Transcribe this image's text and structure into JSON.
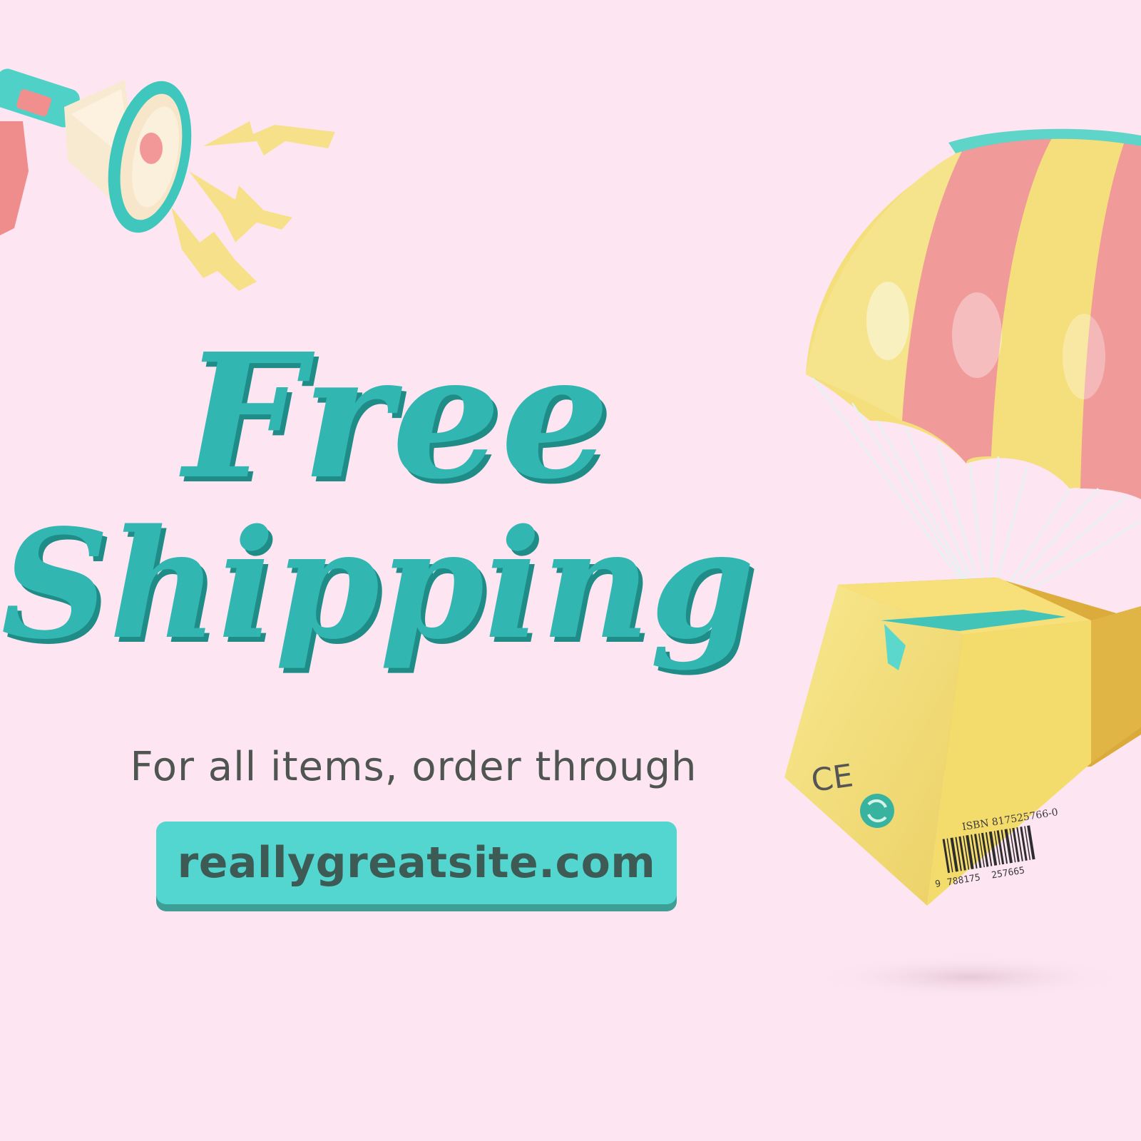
{
  "headline": {
    "line1": "Free",
    "line2": "Shipping"
  },
  "subtitle": "For all items, order through",
  "cta": {
    "url": "reallygreatsite.com"
  },
  "box": {
    "mark": "CE",
    "isbn": "ISBN 817525766-0",
    "barcode_left": "9",
    "barcode_mid": "788175",
    "barcode_right": "257665"
  },
  "colors": {
    "background": "#fde6f2",
    "teal": "#32b6b1",
    "teal_dark": "#1f8c87",
    "button": "#53d6cf",
    "button_shadow": "#3e9f97",
    "text_gray": "#4f5551",
    "pink": "#f09a9a",
    "yellow": "#f5e27c"
  },
  "icons": {
    "megaphone": "megaphone-icon",
    "parachute": "parachute-icon",
    "package": "package-box-icon",
    "recycle": "recycle-icon"
  }
}
